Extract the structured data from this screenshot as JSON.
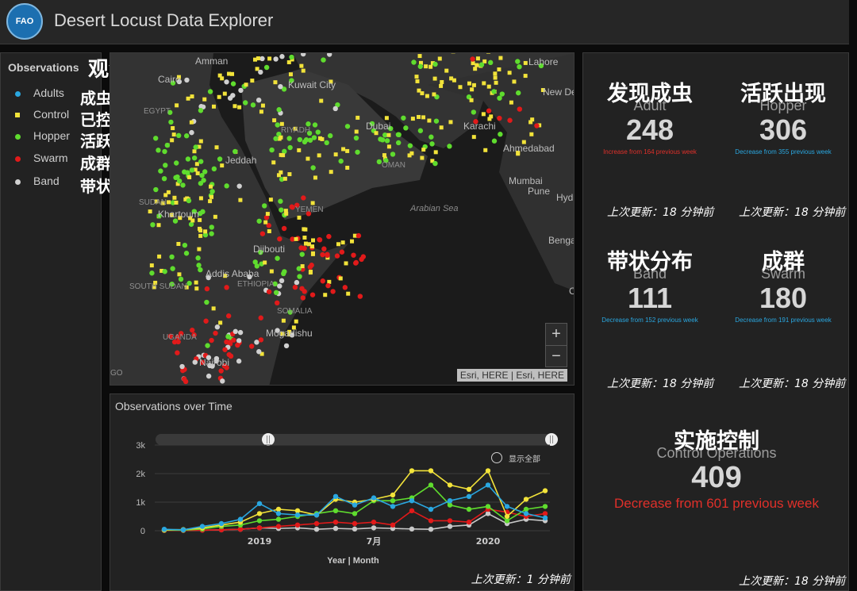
{
  "header": {
    "title": "Desert Locust Data Explorer",
    "logo_text": "FAO"
  },
  "legend": {
    "title": "Observations",
    "title_cn": "观测状态",
    "items": [
      {
        "label": "Adults",
        "cn": "成虫",
        "color": "#2aa7e0",
        "shape": "dot"
      },
      {
        "label": "Control",
        "cn": "已控制",
        "color": "#f2e33a",
        "shape": "square"
      },
      {
        "label": "Hopper",
        "cn": "活跃",
        "color": "#5fdc2e",
        "shape": "dot"
      },
      {
        "label": "Swarm",
        "cn": "成群",
        "color": "#e11a1a",
        "shape": "dot"
      },
      {
        "label": "Band",
        "cn": "带状分布",
        "color": "#d0d0d0",
        "shape": "dot"
      }
    ]
  },
  "map": {
    "labels": {
      "amman": "Amman",
      "cairo": "Cairo",
      "egypt": "EGYPT",
      "kuwait": "Kuwait City",
      "riyadh": "RIYADH",
      "dubai": "Dubai",
      "karachi": "Karachi",
      "lahore": "Lahore",
      "new_delhi": "New Delhi",
      "ahmedabad": "Ahmedabad",
      "jeddah": "Jeddah",
      "oman": "OMAN",
      "mumbai": "Mumbai",
      "pune": "Pune",
      "hyd": "Hyd",
      "sudan": "SUDAN",
      "khartoum": "Khartoum",
      "yemen": "YEMEN",
      "arabian_sea": "Arabian Sea",
      "bengal": "Benga",
      "djibouti": "Djibouti",
      "addis": "Addis Ababa",
      "south_sudan": "SOUTH SUDAN",
      "ethiopia": "ETHIOPIA",
      "somalia": "SOMALIA",
      "mogadishu": "Mogadishu",
      "uganda": "UGANDA",
      "nairobi": "Nairobi",
      "go": "GO",
      "c": "C"
    },
    "zoom_in": "+",
    "zoom_out": "−",
    "attribution": "Esri, HERE | Esri, HERE"
  },
  "chart": {
    "title": "Observations over Time",
    "xlabel": "Year | Month",
    "show_all": "显示全部",
    "updated": "上次更新：1 分钟前"
  },
  "chart_data": {
    "type": "line",
    "title": "Observations over Time",
    "xlabel": "Year | Month",
    "ylabel": "",
    "ylim": [
      0,
      3000
    ],
    "y_ticks": [
      "0",
      "1k",
      "2k",
      "3k"
    ],
    "x_tick_labels": [
      {
        "index": 5,
        "label": "2019"
      },
      {
        "index": 11,
        "label": "7月"
      },
      {
        "index": 17,
        "label": "2020"
      }
    ],
    "x": [
      0,
      1,
      2,
      3,
      4,
      5,
      6,
      7,
      8,
      9,
      10,
      11,
      12,
      13,
      14,
      15,
      16,
      17,
      18,
      19,
      20
    ],
    "series": [
      {
        "name": "Adults",
        "color": "#2aa7e0",
        "values": [
          50,
          30,
          150,
          250,
          400,
          950,
          600,
          550,
          550,
          1200,
          900,
          1150,
          850,
          1050,
          750,
          1050,
          1200,
          1600,
          850,
          600,
          450
        ]
      },
      {
        "name": "Control",
        "color": "#f2e33a",
        "values": [
          30,
          40,
          100,
          200,
          300,
          600,
          750,
          700,
          550,
          1100,
          1000,
          1100,
          1250,
          2100,
          2100,
          1600,
          1450,
          2100,
          500,
          1100,
          1400
        ]
      },
      {
        "name": "Hopper",
        "color": "#5fdc2e",
        "values": [
          20,
          20,
          60,
          150,
          200,
          350,
          400,
          500,
          600,
          700,
          600,
          1050,
          1050,
          1150,
          1600,
          900,
          750,
          850,
          350,
          750,
          850
        ]
      },
      {
        "name": "Swarm",
        "color": "#e11a1a",
        "values": [
          10,
          10,
          20,
          30,
          50,
          100,
          150,
          200,
          250,
          300,
          250,
          300,
          200,
          700,
          350,
          350,
          300,
          750,
          650,
          500,
          600
        ]
      },
      {
        "name": "Band",
        "color": "#c8c8c8",
        "values": [
          10,
          10,
          20,
          30,
          50,
          100,
          80,
          100,
          50,
          80,
          60,
          100,
          80,
          60,
          50,
          150,
          200,
          600,
          250,
          400,
          350
        ]
      }
    ]
  },
  "stats": {
    "cards": [
      {
        "cn": "发现成虫",
        "en": "Adult",
        "value": "248",
        "delta": "Increase from 164 previous week",
        "delta_color": "#e0302a",
        "updated": "上次更新：18 分钟前"
      },
      {
        "cn": "活跃出现",
        "en": "Hopper",
        "value": "306",
        "delta": "Decrease from 355 previous week",
        "delta_color": "#2aa7e0",
        "updated": "上次更新：18 分钟前"
      },
      {
        "cn": "带状分布",
        "en": "Band",
        "value": "111",
        "delta": "Decrease from 152 previous week",
        "delta_color": "#2aa7e0",
        "updated": "上次更新：18 分钟前"
      },
      {
        "cn": "成群",
        "en": "Swarm",
        "value": "180",
        "delta": "Decrease from 191 previous week",
        "delta_color": "#2aa7e0",
        "updated": "上次更新：18 分钟前"
      }
    ],
    "control": {
      "cn": "实施控制",
      "en": "Control Operations",
      "value": "409",
      "delta": "Decrease from 601 previous week",
      "delta_color": "#e0302a",
      "updated": "上次更新：18 分钟前"
    }
  }
}
